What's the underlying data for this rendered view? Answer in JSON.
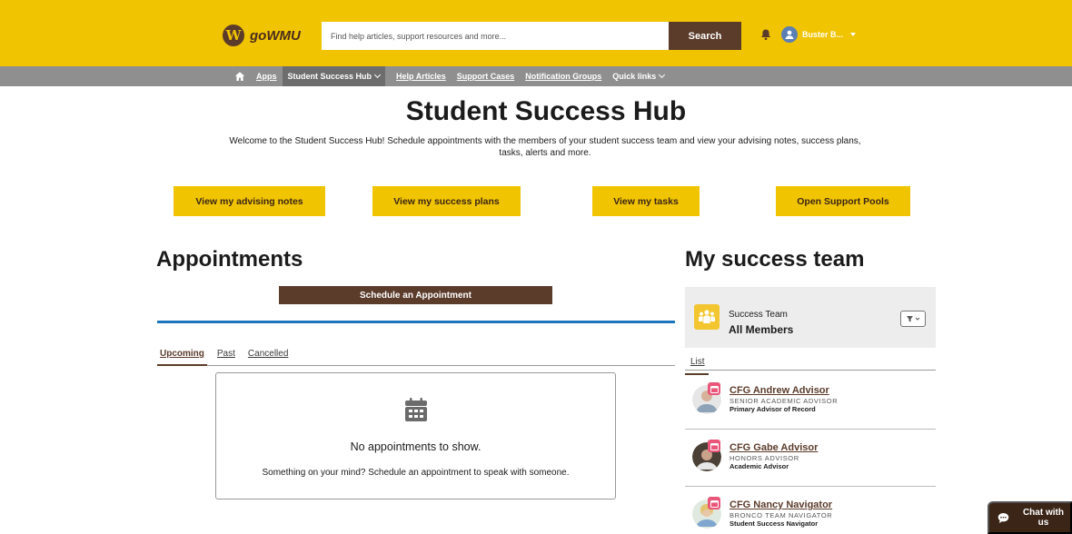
{
  "header": {
    "logo_letter": "W",
    "logo_text": "goWMU",
    "search_placeholder": "Find help articles, support resources and more...",
    "search_button": "Search",
    "user_name": "Buster B..."
  },
  "nav": {
    "apps": "Apps",
    "hub": "Student Success Hub",
    "help": "Help Articles",
    "support": "Support Cases",
    "notification": "Notification Groups",
    "quick": "Quick links"
  },
  "hero": {
    "title": "Student Success Hub",
    "text": "Welcome to the Student Success Hub! Schedule appointments with the members of your student success team and view your advising notes, success plans, tasks, alerts and more."
  },
  "actions": [
    "View my advising notes",
    "View my success plans",
    "View my tasks",
    "Open Support Pools"
  ],
  "appointments": {
    "title": "Appointments",
    "schedule_button": "Schedule an Appointment",
    "tabs": [
      "Upcoming",
      "Past",
      "Cancelled"
    ],
    "empty_title": "No appointments to show.",
    "empty_sub": "Something on your mind? Schedule an appointment to speak with someone."
  },
  "team": {
    "title": "My success team",
    "card_sub": "Success Team",
    "card_name": "All Members",
    "list_tab": "List",
    "members": [
      {
        "name": "CFG Andrew Advisor",
        "role": "SENIOR ACADEMIC ADVISOR",
        "desc": "Primary Advisor of Record"
      },
      {
        "name": "CFG Gabe Advisor",
        "role": "HONORS ADVISOR",
        "desc": "Academic Advisor"
      },
      {
        "name": "CFG Nancy Navigator",
        "role": "BRONCO TEAM NAVIGATOR",
        "desc": "Student Success Navigator"
      }
    ]
  },
  "chat": {
    "label": "Chat with us"
  },
  "colors": {
    "gold": "#f1c400",
    "brown": "#5b3b2a",
    "blue": "#1c75bc",
    "gray_nav": "#8f8f8f"
  }
}
